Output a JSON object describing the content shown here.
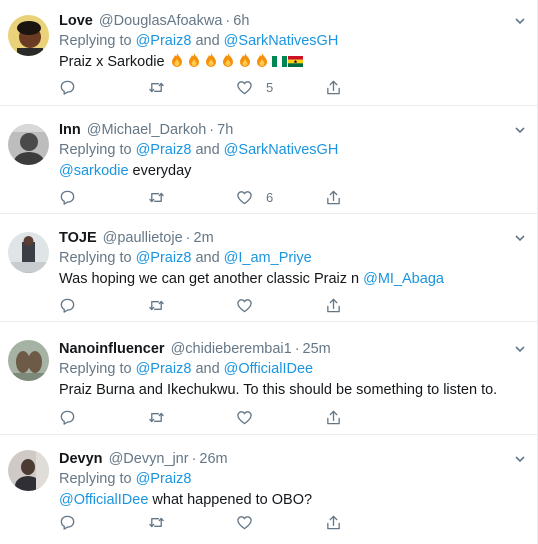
{
  "replying_to_label": "Replying to",
  "and_label": "and",
  "colors": {
    "link": "#1b95e0",
    "muted": "#657786",
    "text": "#14171a",
    "divider": "#e6ecf0"
  },
  "tweets": [
    {
      "name": "Love",
      "handle": "@DouglasAfoakwa",
      "time": "6h",
      "reply_to": [
        "@Praiz8",
        "@SarkNativesGH"
      ],
      "text_prefix": "Praiz x Sarkodie",
      "text_mention": "",
      "text_suffix": "",
      "emojis": [
        "fire",
        "fire",
        "fire",
        "fire",
        "fire",
        "fire",
        "nigeria-flag",
        "ghana-flag"
      ],
      "like_count": "5"
    },
    {
      "name": "Inn",
      "handle": "@Michael_Darkoh",
      "time": "7h",
      "reply_to": [
        "@Praiz8",
        "@SarkNativesGH"
      ],
      "text_prefix": "",
      "text_mention": "@sarkodie",
      "text_suffix": " everyday",
      "like_count": "6"
    },
    {
      "name": "TOJE",
      "handle": "@paullietoje",
      "time": "2m",
      "reply_to": [
        "@Praiz8",
        "@I_am_Priye"
      ],
      "text_prefix": "Was hoping we can get another classic Praiz n ",
      "text_mention": "@MI_Abaga",
      "text_suffix": "",
      "like_count": ""
    },
    {
      "name": "Nanoinfluencer",
      "handle": "@chidieberembai1",
      "time": "25m",
      "reply_to": [
        "@Praiz8",
        "@OfficialIDee"
      ],
      "text_prefix": "Praiz Burna and Ikechukwu. To this should be something to listen to.",
      "text_mention": "",
      "text_suffix": "",
      "like_count": ""
    },
    {
      "name": "Devyn",
      "handle": "@Devyn_jnr",
      "time": "26m",
      "reply_to": [
        "@Praiz8"
      ],
      "text_prefix": "",
      "text_mention": "@OfficialIDee",
      "text_suffix": " what happened to OBO?",
      "like_count": ""
    }
  ]
}
